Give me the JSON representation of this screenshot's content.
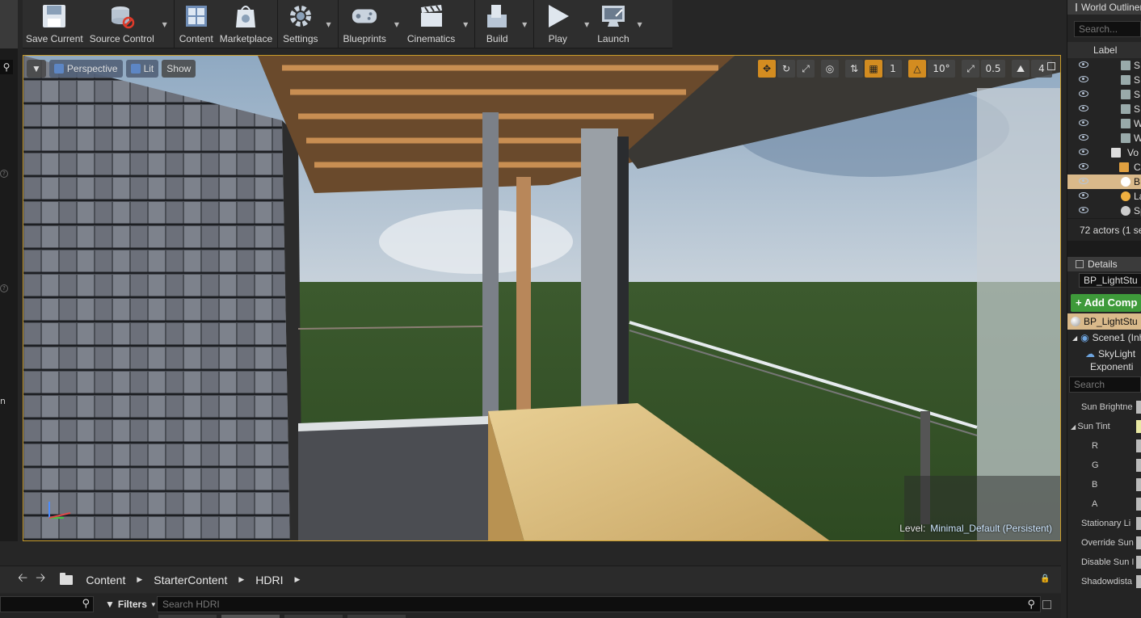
{
  "toolbar": {
    "buttons": [
      {
        "label": "Save Current",
        "icon": "save-icon"
      },
      {
        "label": "Source Control",
        "icon": "source-control-icon"
      },
      {
        "label": "Content",
        "icon": "content-icon"
      },
      {
        "label": "Marketplace",
        "icon": "marketplace-icon"
      },
      {
        "label": "Settings",
        "icon": "settings-icon"
      },
      {
        "label": "Blueprints",
        "icon": "blueprints-icon"
      },
      {
        "label": "Cinematics",
        "icon": "cinematics-icon"
      },
      {
        "label": "Build",
        "icon": "build-icon"
      },
      {
        "label": "Play",
        "icon": "play-icon"
      },
      {
        "label": "Launch",
        "icon": "launch-icon"
      }
    ]
  },
  "viewport": {
    "view_mode": "Perspective",
    "lighting": "Lit",
    "show": "Show",
    "rotation_snap": "10°",
    "scale_snap": "0.5",
    "camera_speed": "4",
    "level_label": "Level:",
    "level_name": "Minimal_Default (Persistent)"
  },
  "content_browser": {
    "breadcrumb": [
      "Content",
      "StarterContent",
      "HDRI"
    ],
    "filters_label": "Filters",
    "search_placeholder": "Search HDRI"
  },
  "outliner": {
    "title": "World Outliner",
    "search_placeholder": "Search...",
    "column_label": "Label",
    "rows": [
      {
        "text": "S",
        "indent": 0,
        "selected": false
      },
      {
        "text": "S",
        "indent": 0,
        "selected": false
      },
      {
        "text": "S",
        "indent": 0,
        "selected": false
      },
      {
        "text": "S",
        "indent": 0,
        "selected": false
      },
      {
        "text": "W",
        "indent": 0,
        "selected": false
      },
      {
        "text": "W",
        "indent": 0,
        "selected": false
      },
      {
        "text": "Vo",
        "indent": 0,
        "selected": false
      },
      {
        "text": "C",
        "indent": 0,
        "selected": false
      },
      {
        "text": "BP",
        "indent": 0,
        "selected": true
      },
      {
        "text": "Lar",
        "indent": 0,
        "selected": false
      },
      {
        "text": "Spl",
        "indent": 0,
        "selected": false
      }
    ],
    "count": "72 actors (1 se"
  },
  "details": {
    "title": "Details",
    "actor_name": "BP_LightStu",
    "add_component": "+ Add Comp",
    "selected_component": "BP_LightStu",
    "components": [
      "Scene1 (Inh",
      "SkyLight",
      "Exponenti"
    ],
    "search_placeholder": "Search",
    "properties": [
      {
        "label": "Sun Brightne",
        "indent": false
      },
      {
        "label": "Sun Tint",
        "indent": false,
        "expand": true
      },
      {
        "label": "R",
        "indent": true
      },
      {
        "label": "G",
        "indent": true
      },
      {
        "label": "B",
        "indent": true
      },
      {
        "label": "A",
        "indent": true
      },
      {
        "label": "Stationary Li",
        "indent": false
      },
      {
        "label": "Override Sun",
        "indent": false
      },
      {
        "label": "Disable Sun I",
        "indent": false
      },
      {
        "label": "Shadowdista",
        "indent": false
      }
    ]
  },
  "left_panel": {
    "fragment": "n"
  }
}
